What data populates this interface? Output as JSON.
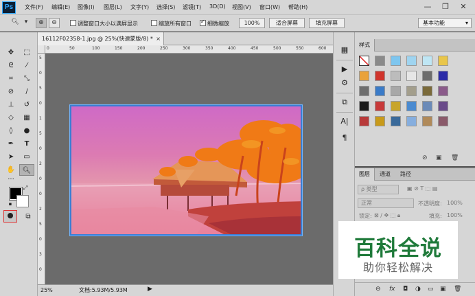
{
  "app": {
    "logo": "Ps"
  },
  "menu": [
    "文件(F)",
    "编辑(E)",
    "图像(I)",
    "图层(L)",
    "文字(Y)",
    "选择(S)",
    "滤镜(T)",
    "3D(D)",
    "视图(V)",
    "窗口(W)",
    "帮助(H)"
  ],
  "window_controls": {
    "minimize": "—",
    "restore": "❐",
    "close": "✕"
  },
  "options": {
    "tool_icon": "zoom-icon",
    "resize_windows_label": "调整窗口大小以满屏显示",
    "resize_windows_checked": false,
    "zoom_all_label": "缩放所有窗口",
    "zoom_all_checked": false,
    "scrubby_zoom_label": "细微缩放",
    "scrubby_zoom_checked": true,
    "zoom_value": "100%",
    "fit_screen_label": "适合屏幕",
    "fill_screen_label": "填充屏幕",
    "workspace": "基本功能"
  },
  "document": {
    "tab_title": "16112F02358-1.jpg @ 25%(快速蒙版/8) *",
    "tab_close": "×",
    "zoom": "25%",
    "doc_info": "文档:5.93M/5.93M",
    "status_arrow": "▶"
  },
  "ruler_h": [
    "0",
    "50",
    "100",
    "150",
    "200",
    "250",
    "300",
    "350",
    "400",
    "450",
    "500",
    "550",
    "600",
    "650"
  ],
  "ruler_v": [
    "5",
    "0",
    "5",
    "0",
    "1",
    "5",
    "0",
    "2",
    "0",
    "0",
    "2",
    "5",
    "0",
    "3",
    "0"
  ],
  "styles_panel": {
    "tab": "样式",
    "swatch_colors": [
      "#ffffff",
      "#8a8a8a",
      "#7ec6ef",
      "#9fd4f0",
      "#bfe6f4",
      "#e9c64a",
      "#e9a23a",
      "#d0342c",
      "#bcbcbc",
      "#e6e6e6",
      "#6d6d6d",
      "#2a2aa8",
      "#6e6e6e",
      "#3a7bc8",
      "#a8a8a8",
      "#a39e8c",
      "#7a6a3a",
      "#8a5a8a",
      "#1a1a1a",
      "#c83a3a",
      "#c8a52a",
      "#4a8ad0",
      "#6a8ab8",
      "#6a4a8a",
      "#b83a3a",
      "#c89a1a",
      "#3a6a9a",
      "#86aede",
      "#b08a5a",
      "#8a5a6a"
    ]
  },
  "layers_panel": {
    "tabs": [
      "图层",
      "通道",
      "路径"
    ],
    "filter_label": "ρ 类型",
    "blend_mode": "正常",
    "opacity_label": "不透明度:",
    "opacity_value": "100%",
    "lock_label": "锁定:",
    "fill_label": "填充:",
    "fill_value": "100%"
  },
  "watermark": {
    "title": "百科全说",
    "subtitle": "助你轻松解决"
  },
  "colors": {
    "accent": "#31a8ff",
    "photo_sky": "#d36fbf",
    "photo_sea": "#e47f9d",
    "palm": "#f07a16"
  }
}
